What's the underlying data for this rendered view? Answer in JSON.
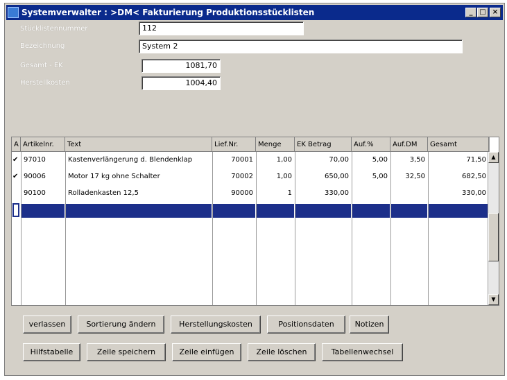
{
  "window": {
    "title": "Systemverwalter : >DM< Fakturierung Produktionsstücklisten",
    "controls": {
      "minimize": "_",
      "maximize": "□",
      "close": "×"
    }
  },
  "form": {
    "stueckliste_label": "Stücklistennummer",
    "stueckliste_value": "112",
    "bezeichnung_label": "Bezeichnung",
    "bezeichnung_value": "System 2",
    "gesamt_ek_label": "Gesamt - EK",
    "gesamt_ek_value": "1081,70",
    "herstellkosten_label": "Herstellkosten",
    "herstellkosten_value": "1004,40"
  },
  "table": {
    "columns": [
      "A",
      "Artikelnr.",
      "Text",
      "Lief.Nr.",
      "Menge",
      "EK Betrag",
      "Auf.%",
      "Auf.DM",
      "Gesamt"
    ],
    "rows": [
      {
        "check": "✔",
        "artikel": "97010",
        "text": "Kastenverlängerung d. Blendenklap",
        "lief": "70001",
        "menge": "1,00",
        "ek": "70,00",
        "aufp": "5,00",
        "aufdm": "3,50",
        "gesamt": "71,50"
      },
      {
        "check": "✔",
        "artikel": "90006",
        "text": "Motor 17 kg ohne Schalter",
        "lief": "70002",
        "menge": "1,00",
        "ek": "650,00",
        "aufp": "5,00",
        "aufdm": "32,50",
        "gesamt": "682,50"
      },
      {
        "check": "",
        "artikel": "90100",
        "text": "Rolladenkasten 12,5",
        "lief": "90000",
        "menge": "1",
        "ek": "330,00",
        "aufp": "",
        "aufdm": "",
        "gesamt": "330,00"
      }
    ]
  },
  "buttons": {
    "row1": [
      "verlassen",
      "Sortierung ändern",
      "Herstellungskosten",
      "Positionsdaten",
      "Notizen"
    ],
    "row2": [
      "Hilfstabelle",
      "Zeile speichern",
      "Zeile einfügen",
      "Zeile löschen",
      "Tabellenwechsel"
    ]
  },
  "icons": {
    "app": "app-icon",
    "scroll_up": "scroll-up-arrow-icon",
    "scroll_down": "scroll-down-arrow-icon",
    "check": "checkmark-icon"
  },
  "colors": {
    "titlebar": "#0a2a8c",
    "selection": "#1c2f8a",
    "window_bg": "#d4d0c8"
  }
}
